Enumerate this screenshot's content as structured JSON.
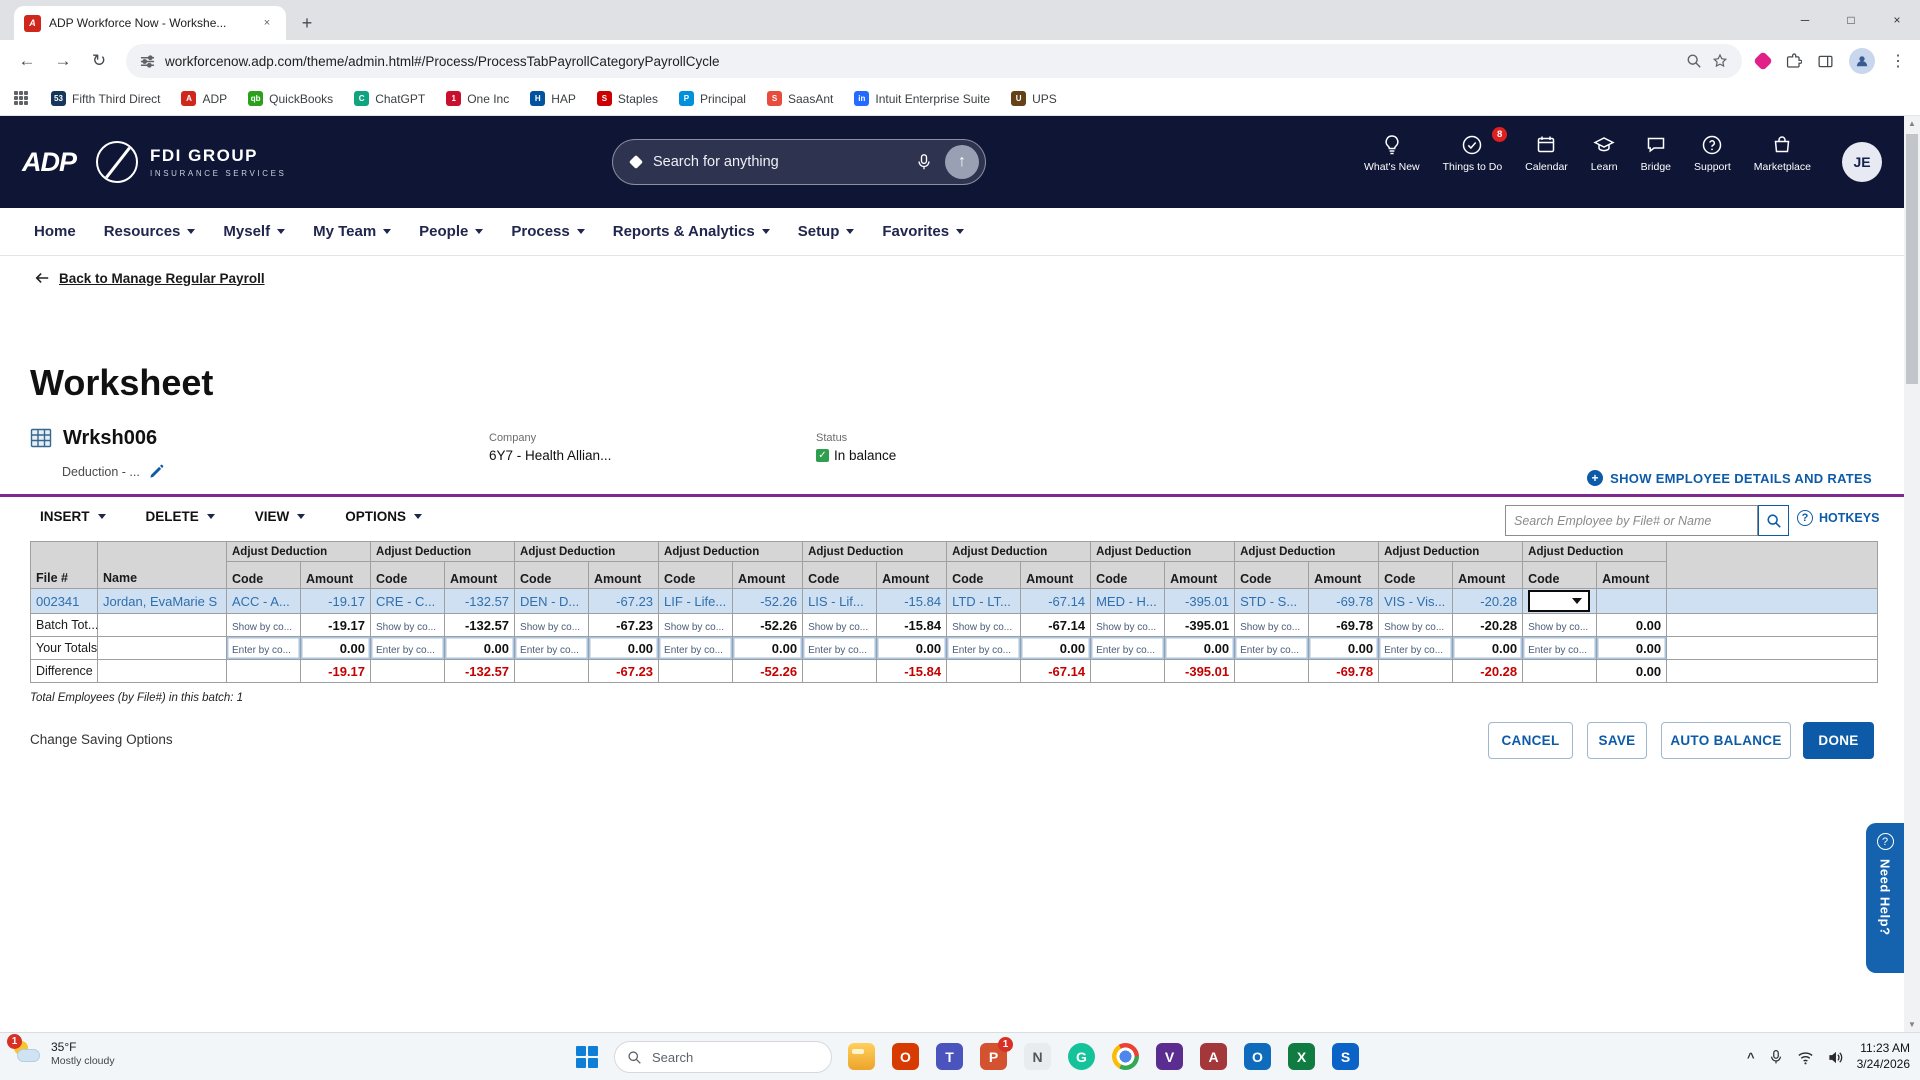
{
  "colors": {
    "header_navy": "#0f1535",
    "link_blue": "#0d5ba8",
    "selected_row": "#cfe0f2",
    "selected_text": "#2e6fae",
    "negative_red": "#c40000",
    "rule_purple": "#7d2b8f",
    "success_green": "#2f9e4f",
    "done_blue": "#0d5ba8"
  },
  "icons": {
    "close": "×",
    "minimize": "─",
    "maximize": "□",
    "plus": "+",
    "back_arrow": "←",
    "forward_arrow": "→",
    "reload": "↻",
    "up_arrow": "↑",
    "kebab": "⋮",
    "question": "?",
    "check": "✓",
    "chevron_up": "^",
    "scroll_up": "▲",
    "scroll_down": "▼"
  },
  "browser": {
    "tab_title": "ADP Workforce Now - Workshe...",
    "tab_favicon": "A",
    "url": "workforcenow.adp.com/theme/admin.html#/Process/ProcessTabPayrollCategoryPayrollCycle",
    "bookmarks": [
      {
        "label": "Fifth Third Direct",
        "initial": "53",
        "color": "#16365c"
      },
      {
        "label": "ADP",
        "initial": "A",
        "color": "#d0271d"
      },
      {
        "label": "QuickBooks",
        "initial": "qb",
        "color": "#2ca01c"
      },
      {
        "label": "ChatGPT",
        "initial": "C",
        "color": "#0fa37f"
      },
      {
        "label": "One Inc",
        "initial": "1",
        "color": "#c8102e"
      },
      {
        "label": "HAP",
        "initial": "H",
        "color": "#00549f"
      },
      {
        "label": "Staples",
        "initial": "S",
        "color": "#cc0000"
      },
      {
        "label": "Principal",
        "initial": "P",
        "color": "#0091da"
      },
      {
        "label": "SaasAnt",
        "initial": "S",
        "color": "#e74c3c"
      },
      {
        "label": "Intuit Enterprise Suite",
        "initial": "in",
        "color": "#236cff"
      },
      {
        "label": "UPS",
        "initial": "U",
        "color": "#644117"
      }
    ]
  },
  "header": {
    "logo_adp": "ADP",
    "brand_name": "FDI GROUP",
    "brand_tagline": "INSURANCE SERVICES",
    "search_placeholder": "Search for anything",
    "icons": [
      {
        "label": "What's New"
      },
      {
        "label": "Things to Do",
        "badge": "8"
      },
      {
        "label": "Calendar"
      },
      {
        "label": "Learn"
      },
      {
        "label": "Bridge"
      },
      {
        "label": "Support"
      },
      {
        "label": "Marketplace"
      }
    ],
    "avatar": "JE"
  },
  "nav": {
    "items": [
      {
        "label": "Home"
      },
      {
        "label": "Resources"
      },
      {
        "label": "Myself"
      },
      {
        "label": "My Team"
      },
      {
        "label": "People"
      },
      {
        "label": "Process"
      },
      {
        "label": "Reports & Analytics"
      },
      {
        "label": "Setup"
      },
      {
        "label": "Favorites"
      }
    ]
  },
  "page": {
    "back_link": "Back to Manage Regular Payroll",
    "title": "Worksheet",
    "worksheet_name": "Wrksh006",
    "worksheet_type": "Deduction - ...",
    "company_label": "Company",
    "company_value": "6Y7 - Health Allian...",
    "status_label": "Status",
    "status_value": "In balance",
    "show_details": "SHOW EMPLOYEE DETAILS AND RATES",
    "toolbar": {
      "insert": "INSERT",
      "delete": "DELETE",
      "view": "VIEW",
      "options": "OPTIONS",
      "search_placeholder": "Search Employee by File# or Name",
      "hotkeys": "HOTKEYS"
    },
    "table": {
      "group_header": "Adjust Deduction",
      "columns": {
        "file": "File #",
        "name": "Name",
        "code": "Code",
        "amount": "Amount"
      },
      "employee": {
        "file_number": "002341",
        "name": "Jordan, EvaMarie S",
        "deductions": [
          {
            "code": "ACC - A...",
            "amount": "-19.17"
          },
          {
            "code": "CRE - C...",
            "amount": "-132.57"
          },
          {
            "code": "DEN - D...",
            "amount": "-67.23"
          },
          {
            "code": "LIF - Life...",
            "amount": "-52.26"
          },
          {
            "code": "LIS - Lif...",
            "amount": "-15.84"
          },
          {
            "code": "LTD - LT...",
            "amount": "-67.14"
          },
          {
            "code": "MED - H...",
            "amount": "-395.01"
          },
          {
            "code": "STD - S...",
            "amount": "-69.78"
          },
          {
            "code": "VIS - Vis...",
            "amount": "-20.28"
          },
          {
            "code": "",
            "amount": "",
            "editing": true
          }
        ]
      },
      "batch_totals": {
        "label": "Batch Tot...",
        "link": "Show by co...",
        "amounts": [
          "-19.17",
          "-132.57",
          "-67.23",
          "-52.26",
          "-15.84",
          "-67.14",
          "-395.01",
          "-69.78",
          "-20.28",
          "0.00"
        ]
      },
      "your_totals": {
        "label": "Your Totals",
        "link": "Enter by co...",
        "amounts": [
          "0.00",
          "0.00",
          "0.00",
          "0.00",
          "0.00",
          "0.00",
          "0.00",
          "0.00",
          "0.00",
          "0.00"
        ]
      },
      "difference": {
        "label": "Difference",
        "amounts": [
          "-19.17",
          "-132.57",
          "-67.23",
          "-52.26",
          "-15.84",
          "-67.14",
          "-395.01",
          "-69.78",
          "-20.28",
          "0.00"
        ]
      }
    },
    "footnote": "Total Employees (by File#) in this batch: 1",
    "change_saving_link": "Change Saving Options",
    "buttons": {
      "cancel": "CANCEL",
      "save": "SAVE",
      "auto_balance": "AUTO BALANCE",
      "done": "DONE"
    },
    "need_help": "Need Help?"
  },
  "taskbar": {
    "weather_badge": "1",
    "weather_temp": "35°F",
    "weather_desc": "Mostly cloudy",
    "search_placeholder": "Search",
    "apps": [
      {
        "name": "file-explorer",
        "color": "",
        "glyph": ""
      },
      {
        "name": "office",
        "color": "#d83b01",
        "glyph": "O"
      },
      {
        "name": "teams",
        "color": "#4b53bc",
        "glyph": "T"
      },
      {
        "name": "powerpoint",
        "color": "#d35230",
        "glyph": "P",
        "badge": "1"
      },
      {
        "name": "notepad",
        "color": "#e9ecef",
        "glyph": "N",
        "fg": "#555555"
      },
      {
        "name": "grammarly",
        "color": "#15c39a",
        "glyph": "G"
      },
      {
        "name": "chrome",
        "color": "",
        "glyph": ""
      },
      {
        "name": "visual-studio",
        "color": "#5c2d91",
        "glyph": "V"
      },
      {
        "name": "access",
        "color": "#a4373a",
        "glyph": "A"
      },
      {
        "name": "outlook",
        "color": "#0f6cbd",
        "glyph": "O"
      },
      {
        "name": "excel",
        "color": "#107c41",
        "glyph": "X"
      },
      {
        "name": "store",
        "color": "#0c63c7",
        "glyph": "S"
      }
    ],
    "time": "11:23 AM",
    "date": "3/24/2026"
  }
}
